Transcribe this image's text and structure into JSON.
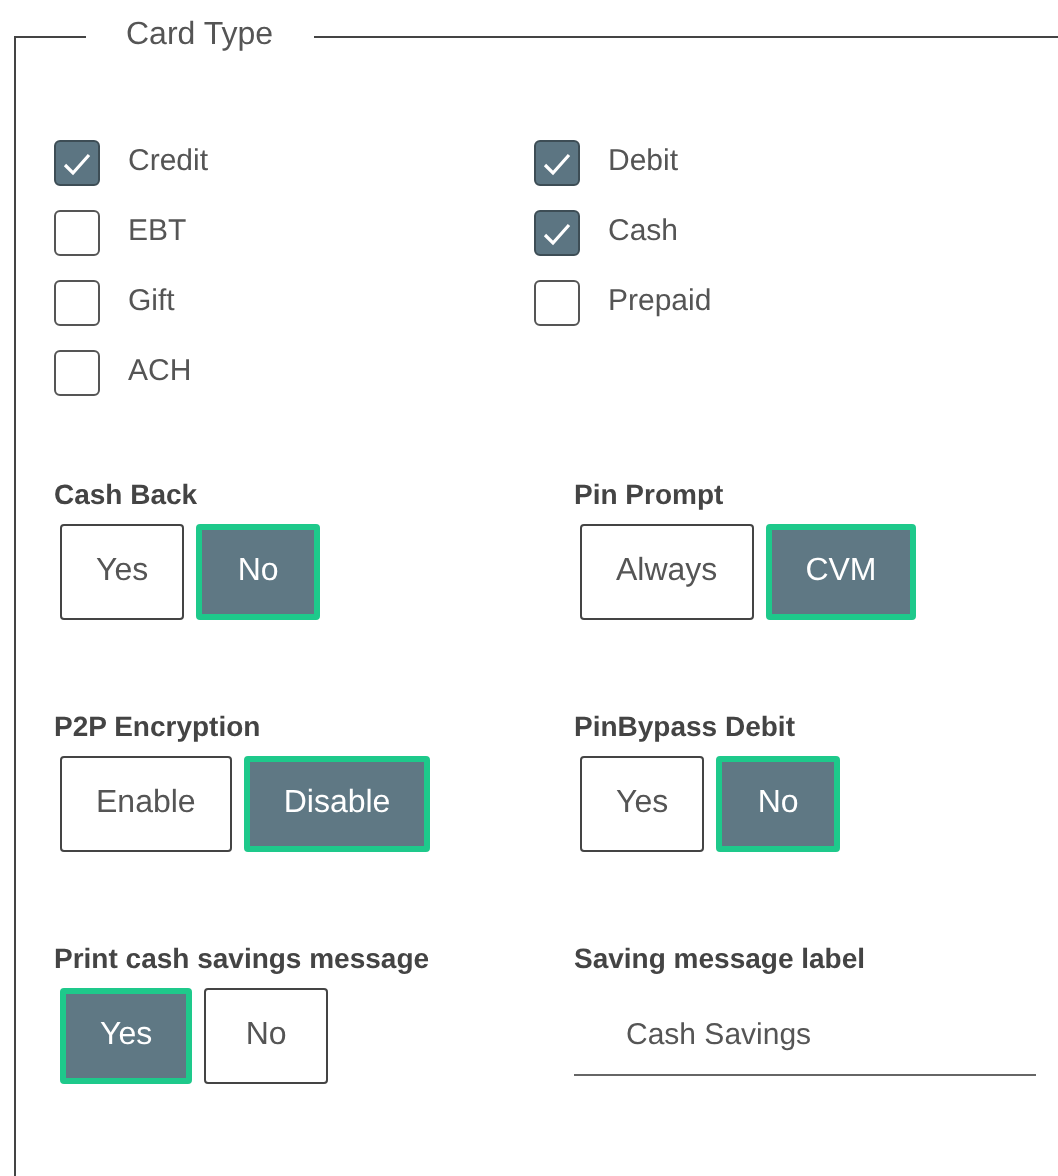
{
  "card_type": {
    "legend": "Card Type",
    "options": [
      {
        "label": "Credit",
        "checked": true
      },
      {
        "label": "Debit",
        "checked": true
      },
      {
        "label": "EBT",
        "checked": false
      },
      {
        "label": "Cash",
        "checked": true
      },
      {
        "label": "Gift",
        "checked": false
      },
      {
        "label": "Prepaid",
        "checked": false
      },
      {
        "label": "ACH",
        "checked": false
      }
    ]
  },
  "settings": [
    {
      "kind": "toggle",
      "label": "Cash Back",
      "options": [
        {
          "label": "Yes",
          "selected": false
        },
        {
          "label": "No",
          "selected": true
        }
      ]
    },
    {
      "kind": "toggle",
      "label": "Pin Prompt",
      "options": [
        {
          "label": "Always",
          "selected": false
        },
        {
          "label": "CVM",
          "selected": true
        }
      ]
    },
    {
      "kind": "toggle",
      "label": "P2P Encryption",
      "options": [
        {
          "label": "Enable",
          "selected": false
        },
        {
          "label": "Disable",
          "selected": true
        }
      ]
    },
    {
      "kind": "toggle",
      "label": "PinBypass Debit",
      "options": [
        {
          "label": "Yes",
          "selected": false
        },
        {
          "label": "No",
          "selected": true
        }
      ]
    },
    {
      "kind": "toggle",
      "label": "Print cash savings message",
      "options": [
        {
          "label": "Yes",
          "selected": true
        },
        {
          "label": "No",
          "selected": false
        }
      ]
    },
    {
      "kind": "text",
      "label": "Saving message label",
      "value": "Cash Savings"
    }
  ]
}
